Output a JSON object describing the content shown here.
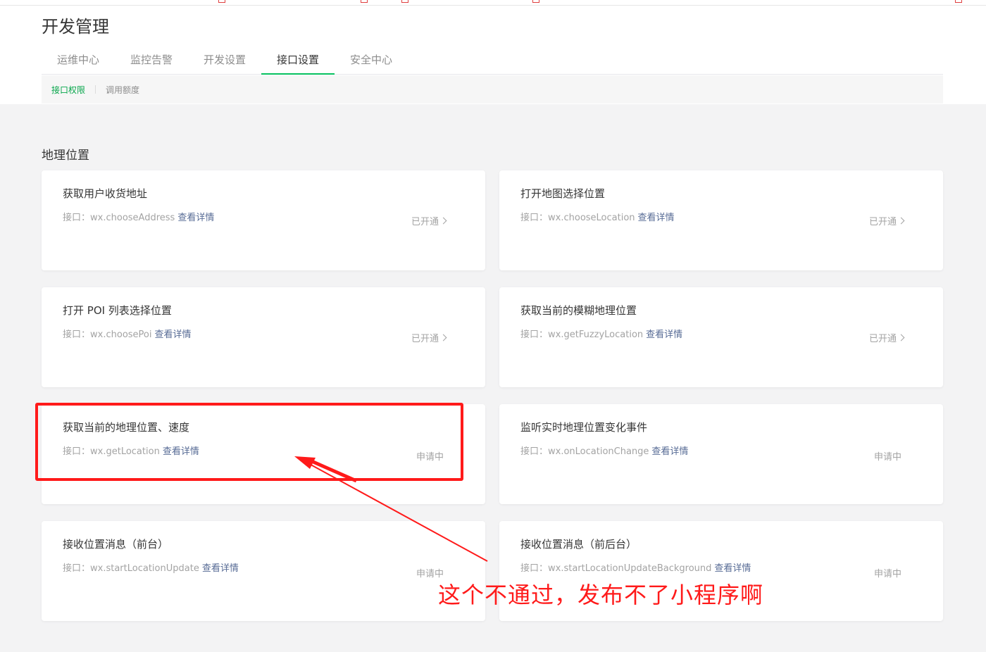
{
  "page": {
    "title": "开发管理"
  },
  "tabs": [
    {
      "label": "运维中心",
      "active": false
    },
    {
      "label": "监控告警",
      "active": false
    },
    {
      "label": "开发设置",
      "active": false
    },
    {
      "label": "接口设置",
      "active": true
    },
    {
      "label": "安全中心",
      "active": false
    }
  ],
  "subtabs": [
    {
      "label": "接口权限",
      "active": true
    },
    {
      "label": "调用额度",
      "active": false
    }
  ],
  "section": {
    "title": "地理位置"
  },
  "api_prefix": "接口：",
  "detail_link": "查看详情",
  "cards": [
    {
      "title": "获取用户收货地址",
      "api": "wx.chooseAddress",
      "status": "已开通"
    },
    {
      "title": "打开地图选择位置",
      "api": "wx.chooseLocation",
      "status": "已开通"
    },
    {
      "title": "打开 POI 列表选择位置",
      "api": "wx.choosePoi",
      "status": "已开通"
    },
    {
      "title": "获取当前的模糊地理位置",
      "api": "wx.getFuzzyLocation",
      "status": "已开通"
    },
    {
      "title": "获取当前的地理位置、速度",
      "api": "wx.getLocation",
      "status": "申请中"
    },
    {
      "title": "监听实时地理位置变化事件",
      "api": "wx.onLocationChange",
      "status": "申请中"
    },
    {
      "title": "接收位置消息（前台）",
      "api": "wx.startLocationUpdate",
      "status": "申请中"
    },
    {
      "title": "接收位置消息（前后台）",
      "api": "wx.startLocationUpdateBackground",
      "status": "申请中"
    }
  ],
  "annotation": {
    "text": "这个不通过，发布不了小程序啊",
    "color": "#ff1a1a"
  },
  "colors": {
    "accent": "#07c160",
    "link": "#576b95"
  }
}
